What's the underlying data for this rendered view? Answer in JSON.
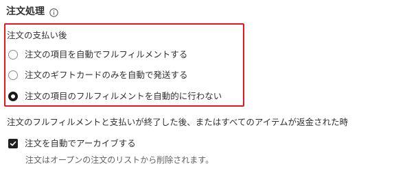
{
  "section": {
    "title": "注文処理",
    "info_icon": "info-icon"
  },
  "after_payment": {
    "label": "注文の支払い後",
    "options": [
      {
        "label": "注文の項目を自動でフルフィルメントする",
        "selected": false
      },
      {
        "label": "注文のギフトカードのみを自動で発送する",
        "selected": false
      },
      {
        "label": "注文の項目のフルフィルメントを自動的に行わない",
        "selected": true
      }
    ]
  },
  "archive": {
    "description": "注文のフルフィルメントと支払いが終了した後、またはすべてのアイテムが返金された時",
    "checkbox_label": "注文を自動でアーカイブする",
    "checked": true,
    "help_text": "注文はオープンの注文のリストから削除されます。"
  },
  "colors": {
    "highlight": "#e3141f",
    "text": "#303030",
    "muted": "#616161",
    "control": "#1f1f1f"
  }
}
